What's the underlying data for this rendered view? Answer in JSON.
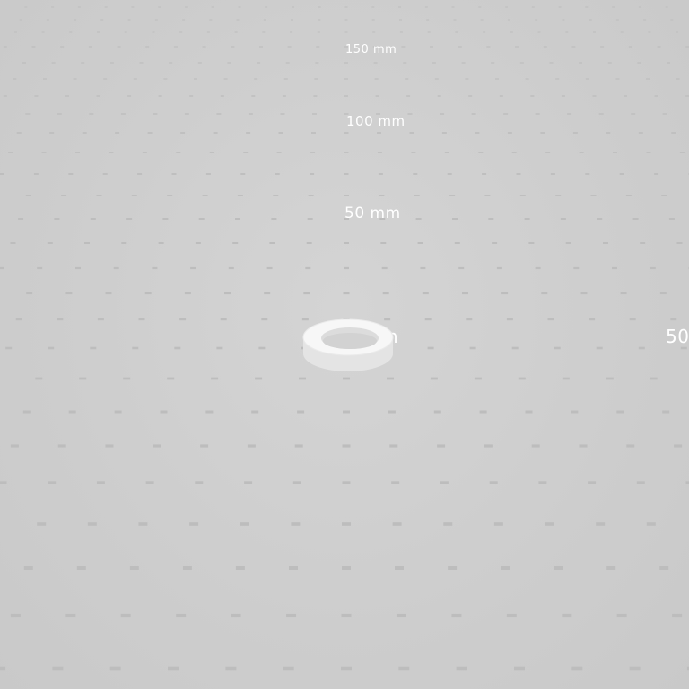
{
  "viewport": {
    "background_color": "#cfcfcf",
    "grid_color": "#bdbdbd"
  },
  "axis_labels": {
    "y_150": "150 mm",
    "y_100": "100 mm",
    "y_50": "50 mm",
    "origin": "0 mm",
    "x_50": "50"
  },
  "model": {
    "shape": "ring",
    "color": "#f2f2f2"
  }
}
